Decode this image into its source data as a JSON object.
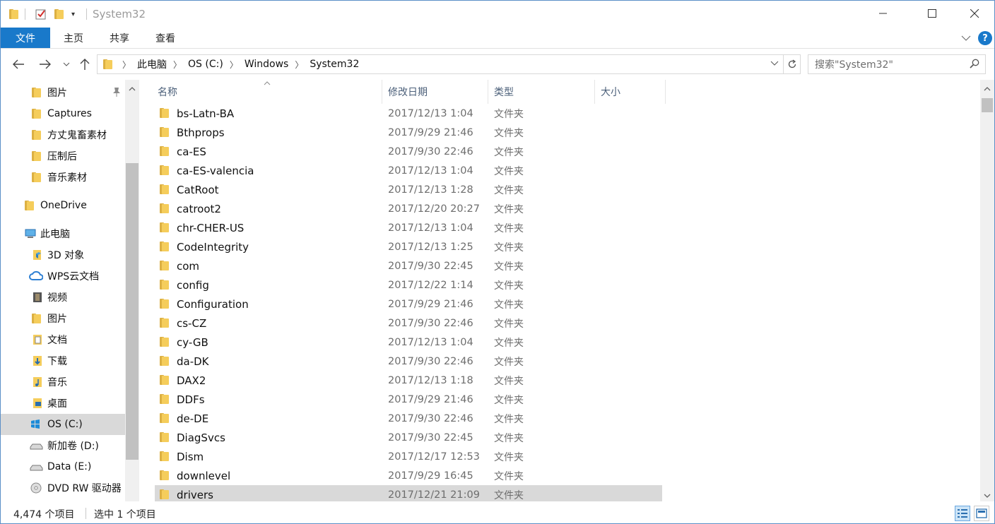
{
  "window": {
    "title": "System32",
    "controls": {
      "minimize": "—",
      "maximize": "☐",
      "close": "✕"
    }
  },
  "ribbon": {
    "tabs": [
      "文件",
      "主页",
      "共享",
      "查看"
    ]
  },
  "address": {
    "crumbs": [
      "此电脑",
      "OS (C:)",
      "Windows",
      "System32"
    ],
    "search_placeholder": "搜索\"System32\""
  },
  "nav": {
    "items": [
      {
        "label": "图片",
        "icon": "pictures-icon",
        "pinned": true
      },
      {
        "label": "Captures",
        "icon": "folder-icon"
      },
      {
        "label": "方丈鬼畜素材",
        "icon": "folder-icon"
      },
      {
        "label": "压制后",
        "icon": "folder-icon"
      },
      {
        "label": "音乐素材",
        "icon": "folder-icon"
      },
      {
        "label": "OneDrive",
        "icon": "onedrive-icon"
      },
      {
        "label": "此电脑",
        "icon": "this-pc-icon"
      },
      {
        "label": "3D 对象",
        "icon": "3d-objects-icon"
      },
      {
        "label": "WPS云文档",
        "icon": "wps-cloud-icon"
      },
      {
        "label": "视频",
        "icon": "videos-icon"
      },
      {
        "label": "图片",
        "icon": "pictures-icon"
      },
      {
        "label": "文档",
        "icon": "documents-icon"
      },
      {
        "label": "下载",
        "icon": "downloads-icon"
      },
      {
        "label": "音乐",
        "icon": "music-icon"
      },
      {
        "label": "桌面",
        "icon": "desktop-icon"
      },
      {
        "label": "OS (C:)",
        "icon": "windows-drive-icon"
      },
      {
        "label": "新加卷 (D:)",
        "icon": "drive-icon"
      },
      {
        "label": "Data (E:)",
        "icon": "drive-icon"
      },
      {
        "label": "DVD RW 驱动器",
        "icon": "dvd-drive-icon"
      }
    ]
  },
  "columns": {
    "name": "名称",
    "date": "修改日期",
    "type": "类型",
    "size": "大小"
  },
  "files": [
    {
      "name": "bs-Latn-BA",
      "date": "2017/12/13 1:04",
      "type": "文件夹"
    },
    {
      "name": "Bthprops",
      "date": "2017/9/29 21:46",
      "type": "文件夹"
    },
    {
      "name": "ca-ES",
      "date": "2017/9/30 22:46",
      "type": "文件夹"
    },
    {
      "name": "ca-ES-valencia",
      "date": "2017/12/13 1:04",
      "type": "文件夹"
    },
    {
      "name": "CatRoot",
      "date": "2017/12/13 1:28",
      "type": "文件夹"
    },
    {
      "name": "catroot2",
      "date": "2017/12/20 20:27",
      "type": "文件夹"
    },
    {
      "name": "chr-CHER-US",
      "date": "2017/12/13 1:04",
      "type": "文件夹"
    },
    {
      "name": "CodeIntegrity",
      "date": "2017/12/13 1:25",
      "type": "文件夹"
    },
    {
      "name": "com",
      "date": "2017/9/30 22:45",
      "type": "文件夹"
    },
    {
      "name": "config",
      "date": "2017/12/22 1:14",
      "type": "文件夹"
    },
    {
      "name": "Configuration",
      "date": "2017/9/29 21:46",
      "type": "文件夹"
    },
    {
      "name": "cs-CZ",
      "date": "2017/9/30 22:46",
      "type": "文件夹"
    },
    {
      "name": "cy-GB",
      "date": "2017/12/13 1:04",
      "type": "文件夹"
    },
    {
      "name": "da-DK",
      "date": "2017/9/30 22:46",
      "type": "文件夹"
    },
    {
      "name": "DAX2",
      "date": "2017/12/13 1:18",
      "type": "文件夹"
    },
    {
      "name": "DDFs",
      "date": "2017/9/29 21:46",
      "type": "文件夹"
    },
    {
      "name": "de-DE",
      "date": "2017/9/30 22:46",
      "type": "文件夹"
    },
    {
      "name": "DiagSvcs",
      "date": "2017/9/30 22:45",
      "type": "文件夹"
    },
    {
      "name": "Dism",
      "date": "2017/12/17 12:53",
      "type": "文件夹"
    },
    {
      "name": "downlevel",
      "date": "2017/9/29 16:45",
      "type": "文件夹"
    },
    {
      "name": "drivers",
      "date": "2017/12/21 21:09",
      "type": "文件夹",
      "selected": true
    }
  ],
  "status": {
    "item_count": "4,474 个项目",
    "selected_count": "选中 1 个项目"
  },
  "colors": {
    "accent": "#1979ca",
    "selection": "#d9d9d9",
    "folder": "#f5cd5b"
  }
}
